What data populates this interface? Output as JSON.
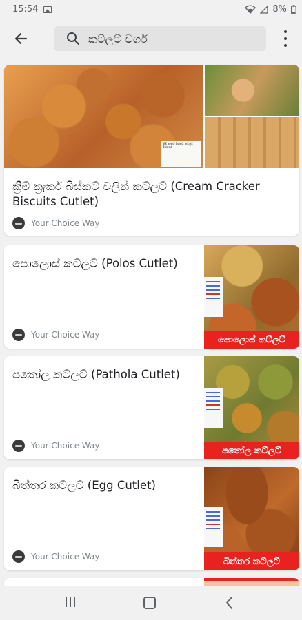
{
  "status_bar": {
    "time": "15:54",
    "battery": "8%"
  },
  "search": {
    "query": "කට්ලට් වර්ග"
  },
  "cards": [
    {
      "title": "ක්‍රීම් ක්‍රැකර් බිස්කට් වලින් කට්ලට් (Cream Cracker Biscuits Cutlet)",
      "source": "Your Choice Way",
      "image_label": "",
      "hero_note": "ක්‍රීම් ක්‍රැකර් බිස්කට් කට්ලට් විස්කෝ"
    },
    {
      "title": "පොලොස් කට්ලට් (Polos Cutlet)",
      "source": "Your Choice Way",
      "image_label": "පොලොස් කට්ලට්"
    },
    {
      "title": "පතෝල කට්ලට් (Pathola Cutlet)",
      "source": "Your Choice Way",
      "image_label": "පතෝල කට්ලට්"
    },
    {
      "title": "බිත්තර කට්ලට් (Egg Cutlet)",
      "source": "Your Choice Way",
      "image_label": "බිත්තර කට්ලට්"
    }
  ],
  "icons": {
    "back": "arrow-back-icon",
    "search": "search-icon",
    "more": "more-vert-icon",
    "wifi": "wifi-icon",
    "signal": "signal-icon",
    "battery": "battery-icon"
  },
  "colors": {
    "banner_red": "#e8231f",
    "background": "#f1f1f1",
    "card": "#ffffff"
  }
}
